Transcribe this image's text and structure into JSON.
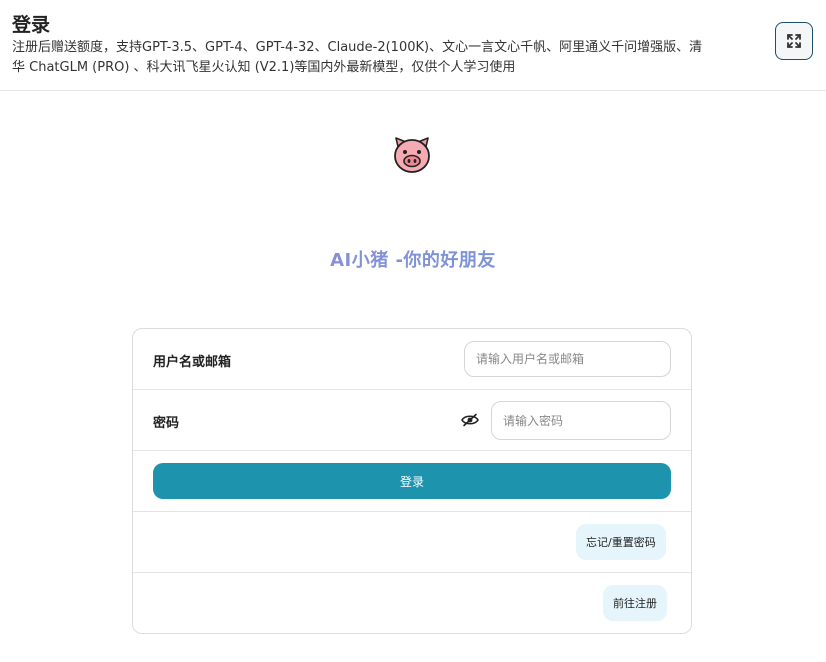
{
  "header": {
    "title": "登录",
    "subtitle": "注册后赠送额度，支持GPT-3.5、GPT-4、GPT-4-32、Claude-2(100K)、文心一言文心千帆、阿里通义千问增强版、清华 ChatGLM (PRO) 、科大讯飞星火认知 (V2.1)等国内外最新模型，仅供个人学习使用",
    "fullscreen_icon": "fullscreen-icon"
  },
  "logo": {
    "icon": "pig-face-icon"
  },
  "brand": {
    "text": "AI小猪 -你的好朋友"
  },
  "form": {
    "username_label": "用户名或邮箱",
    "username_placeholder": "请输入用户名或邮箱",
    "username_value": "",
    "password_label": "密码",
    "password_placeholder": "请输入密码",
    "password_value": "",
    "eye_icon": "eye-slash-icon",
    "login_label": "登录",
    "forgot_label": "忘记/重置密码",
    "register_label": "前往注册"
  },
  "colors": {
    "primary": "#1e93ad",
    "soft_button": "#e6f5fb",
    "brand_gradient_start": "#a28ad6",
    "brand_gradient_end": "#5f9ad6"
  }
}
